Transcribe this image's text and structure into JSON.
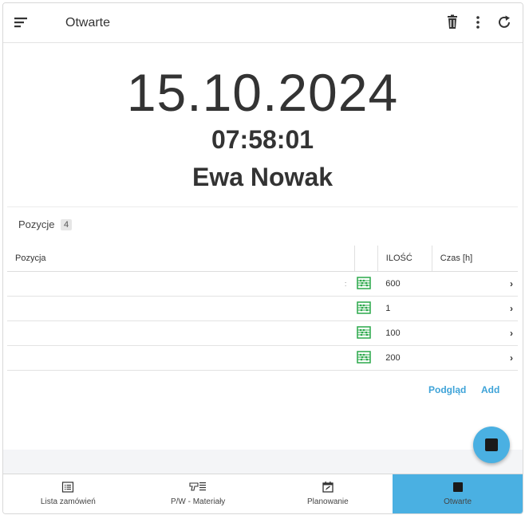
{
  "header": {
    "title": "Otwarte",
    "icons": [
      "menu-icon",
      "trash-icon",
      "more-vertical-icon",
      "refresh-icon"
    ]
  },
  "order": {
    "date": "15.10.2024",
    "time": "07:58:01",
    "name": "Ewa Nowak"
  },
  "positions": {
    "label": "Pozycje",
    "count": "4",
    "columns": {
      "position": "Pozycja",
      "quantity": "ILOŚĆ",
      "time": "Czas [h]"
    },
    "rows": [
      {
        "position": "",
        "quantity": "600",
        "time": ""
      },
      {
        "position": "",
        "quantity": "1",
        "time": ""
      },
      {
        "position": "",
        "quantity": "100",
        "time": ""
      },
      {
        "position": "",
        "quantity": "200",
        "time": ""
      }
    ]
  },
  "actions": {
    "preview": "Podgląd",
    "add": "Add"
  },
  "nav": [
    {
      "label": "Lista zamówień",
      "icon": "list-icon"
    },
    {
      "label": "P/W - Materiały",
      "icon": "materials-icon"
    },
    {
      "label": "Planowanie",
      "icon": "calendar-edit-icon"
    },
    {
      "label": "Otwarte",
      "icon": "stop-icon"
    }
  ],
  "colors": {
    "accent": "#4ab0e2",
    "link": "#3ea3d8",
    "abacus": "#2aa84a"
  }
}
